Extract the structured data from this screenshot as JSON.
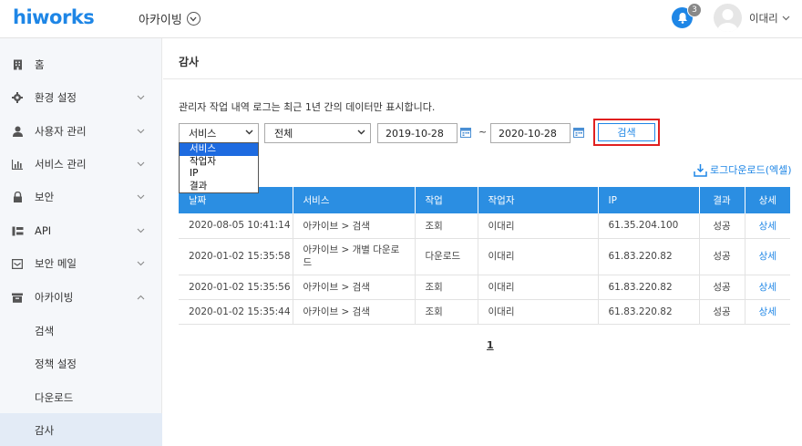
{
  "header": {
    "logo": "hiworks",
    "app_name": "아카이빙",
    "notification_count": "3",
    "user_name": "이대리"
  },
  "sidebar": {
    "items": [
      {
        "label": "홈",
        "icon": "building-icon",
        "has_chevron": false
      },
      {
        "label": "환경 설정",
        "icon": "gear-icon",
        "has_chevron": true
      },
      {
        "label": "사용자 관리",
        "icon": "user-icon",
        "has_chevron": true
      },
      {
        "label": "서비스 관리",
        "icon": "chart-icon",
        "has_chevron": true
      },
      {
        "label": "보안",
        "icon": "lock-icon",
        "has_chevron": true
      },
      {
        "label": "API",
        "icon": "api-icon",
        "has_chevron": true
      },
      {
        "label": "보안 메일",
        "icon": "mail-icon",
        "has_chevron": true
      },
      {
        "label": "아카이빙",
        "icon": "archive-icon",
        "has_chevron": true,
        "expanded": true
      }
    ],
    "sub_items": [
      {
        "label": "검색"
      },
      {
        "label": "정책 설정"
      },
      {
        "label": "다운로드"
      },
      {
        "label": "감사",
        "active": true
      }
    ]
  },
  "main": {
    "title": "감사",
    "notice": "관리자 작업 내역 로그는 최근 1년 간의 데이터만 표시합니다.",
    "filter": {
      "category_value": "서비스",
      "category_options": [
        "서비스",
        "작업자",
        "IP",
        "결과"
      ],
      "scope_value": "전체",
      "date_from": "2019-10-28",
      "date_to": "2020-10-28",
      "tilde": "~",
      "search_label": "검색"
    },
    "download_label": "로그다운로드(엑셀)",
    "table": {
      "headers": [
        "날짜",
        "서비스",
        "작업",
        "작업자",
        "IP",
        "결과",
        "상세"
      ],
      "rows": [
        {
          "date": "2020-08-05 10:41:14",
          "service": "아카이브 > 검색",
          "action": "조회",
          "worker": "이대리",
          "ip": "61.35.204.100",
          "result": "성공",
          "detail": "상세"
        },
        {
          "date": "2020-01-02 15:35:58",
          "service": "아카이브 > 개별 다운로드",
          "action": "다운로드",
          "worker": "이대리",
          "ip": "61.83.220.82",
          "result": "성공",
          "detail": "상세"
        },
        {
          "date": "2020-01-02 15:35:56",
          "service": "아카이브 > 검색",
          "action": "조회",
          "worker": "이대리",
          "ip": "61.83.220.82",
          "result": "성공",
          "detail": "상세"
        },
        {
          "date": "2020-01-02 15:35:44",
          "service": "아카이브 > 검색",
          "action": "조회",
          "worker": "이대리",
          "ip": "61.83.220.82",
          "result": "성공",
          "detail": "상세"
        }
      ]
    },
    "pagination": {
      "current": "1"
    }
  },
  "colors": {
    "accent": "#1e86e6",
    "highlight_border": "#e02020",
    "table_header": "#2b8ee2"
  }
}
